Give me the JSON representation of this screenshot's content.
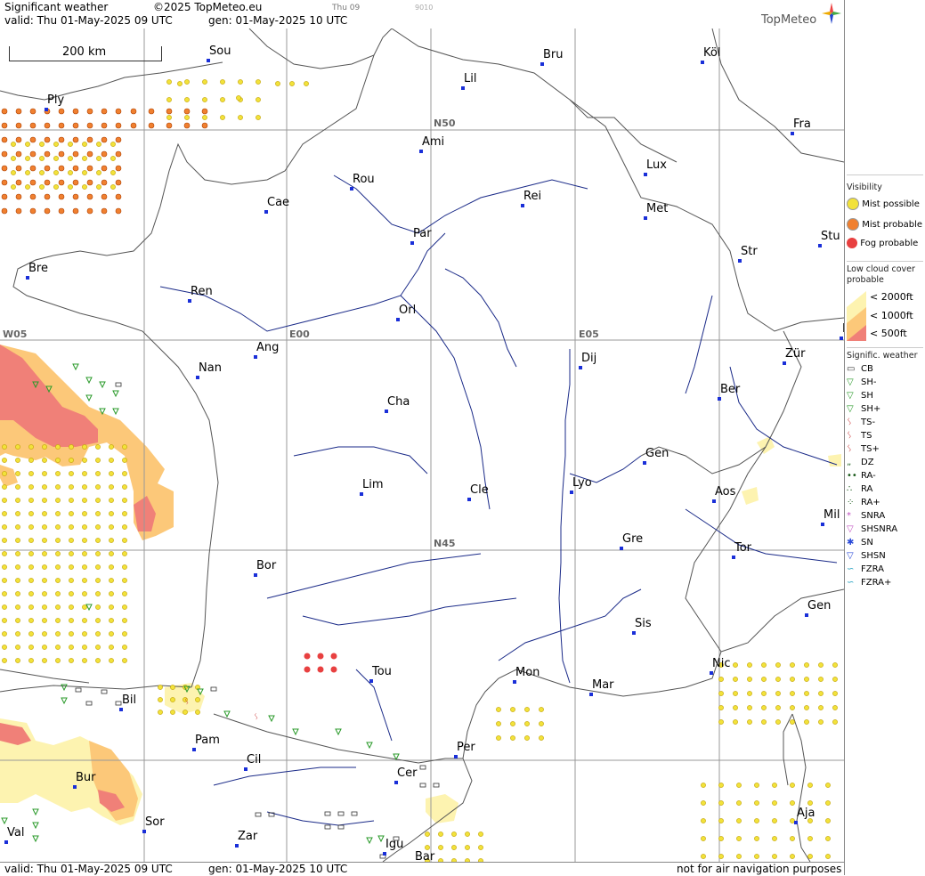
{
  "header": {
    "title": "Significant weather",
    "copyright": "©2025 TopMeteo.eu",
    "time_small": "Thu 09",
    "code_small": "9010",
    "valid": "valid:  Thu  01-May-2025  09 UTC",
    "gen": "gen:  01-May-2025 10 UTC",
    "brand": "TopMeteo"
  },
  "footer": {
    "valid": "valid:  Thu  01-May-2025  09 UTC",
    "gen": "gen:  01-May-2025 10 UTC",
    "disclaimer": "not for air navigation purposes"
  },
  "scale": {
    "label": "200 km"
  },
  "grid_labels": [
    "N50",
    "N45",
    "W05",
    "E00",
    "E05"
  ],
  "cities": [
    "Sou",
    "Bru",
    "Köl",
    "Lil",
    "Ply",
    "Fra",
    "Ami",
    "Lux",
    "Rou",
    "Cae",
    "Rei",
    "Met",
    "Par",
    "Bre",
    "Stu",
    "Str",
    "Ren",
    "Orl",
    "Ang",
    "Dij",
    "Zür",
    "Nan",
    "Ber",
    "Cha",
    "Gen",
    "Lim",
    "Cle",
    "Lyo",
    "Aos",
    "Mil",
    "Gre",
    "Tor",
    "Bor",
    "Gen",
    "Sis",
    "Nic",
    "Tou",
    "Mon",
    "Mar",
    "Bil",
    "Pam",
    "Cil",
    "Per",
    "Bur",
    "Cer",
    "Aja",
    "Sor",
    "Val",
    "Zar",
    "Igu",
    "Bar",
    "F"
  ],
  "legend": {
    "visibility_title": "Visibility",
    "mist_possible": "Mist possible",
    "mist_probable": "Mist probable",
    "fog_probable": "Fog probable",
    "lowcloud_title": "Low cloud cover probable",
    "lc_2000": "< 2000ft",
    "lc_1000": "< 1000ft",
    "lc_500": "<   500ft",
    "sigwx_title": "Signific. weather",
    "items": [
      "CB",
      "SH-",
      "SH",
      "SH+",
      "TS-",
      "TS",
      "TS+",
      "DZ",
      "RA-",
      "RA",
      "RA+",
      "SNRA",
      "SHSNRA",
      "SN",
      "SHSN",
      "FZRA",
      "FZRA+"
    ]
  },
  "colors": {
    "mist_possible": "#f2e23a",
    "mist_probable": "#f08030",
    "fog_probable": "#e84040",
    "lc_2000": "#fdf3b0",
    "lc_1000": "#fcc879",
    "lc_500": "#f08078",
    "city_marker": "#1a2fd8",
    "grid": "#999999",
    "coast": "#555555",
    "river": "#1a2a88",
    "shower": "#2a9a2a",
    "thunder": "#c42020"
  }
}
